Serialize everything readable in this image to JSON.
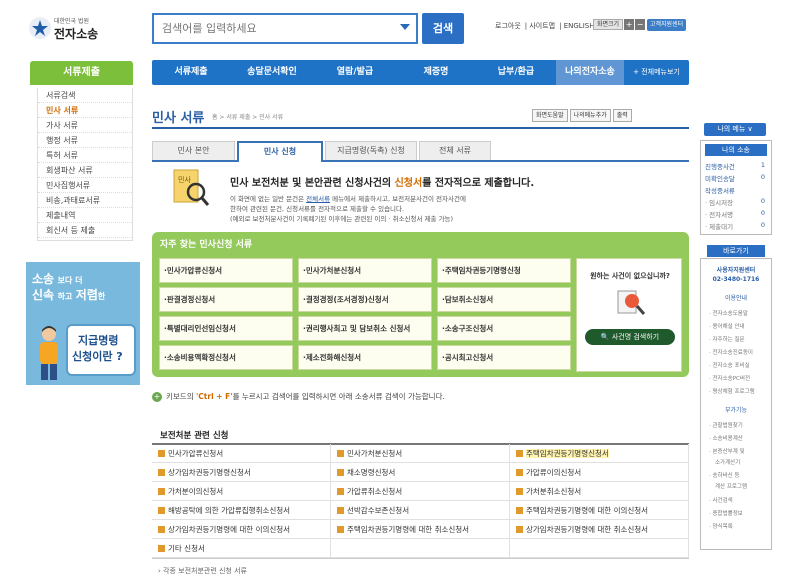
{
  "header": {
    "logo_sub": "대한민국 법원",
    "logo_main": "전자소송",
    "search_placeholder": "검색어를 입력하세요",
    "search_button": "검색",
    "top_links": [
      "로그아웃",
      "사이트맵",
      "ENGLISH"
    ],
    "font_label": "화면크기",
    "font_plus": "+",
    "font_minus": "−",
    "cs_center": "고객지원센터"
  },
  "mainnav": {
    "items": [
      "서류제출",
      "송달문서확인",
      "열람/발급",
      "제증명",
      "납부/환급",
      "나의전자소송"
    ],
    "all_menu": "+ 전체메뉴보기"
  },
  "leftnav": {
    "header": "서류제출",
    "items": [
      "서류검색",
      "민사 서류",
      "가사 서류",
      "행정 서류",
      "특허 서류",
      "회생파산 서류",
      "민사집행서류",
      "비송,과태료서류",
      "제출내역",
      "회신서 등 제출"
    ],
    "active_index": 1
  },
  "banner": {
    "line1_a": "소송",
    "line1_b": "보다 더",
    "line2_a": "신속",
    "line2_b": "하고",
    "line2_c": "저렴",
    "line2_d": "한",
    "bubble1": "지급명령",
    "bubble2": "신청이란 ?"
  },
  "page": {
    "title": "민사 서류",
    "breadcrumb": "홈 > 서류 제출 > 민사 서류",
    "tools": [
      "화면도움말",
      "나의메뉴추가",
      "출력"
    ]
  },
  "tabs": {
    "items": [
      "민사 본안",
      "민사 신청",
      "지급명령(독촉) 신청",
      "전체 서류"
    ],
    "active_index": 1
  },
  "intro": {
    "icon_label": "민사",
    "title_a": "민사 보전처분 및 본안관련 신청사건의 ",
    "title_em": "신청서",
    "title_b": "를 전자적으로 제출합니다.",
    "line1_a": "이 화면에 없는 일반 문건은 ",
    "line1_link": "전체서류",
    "line1_b": " 메뉴에서 제출하시고, 보전처분사건이 전자사건에",
    "line2": "한하여 관련된 문건, 신청서류를 전자적으로 제출할 수 있습니다.",
    "line3": "(예외로 보전처분사건이 기록폐기된 이후에는 관련된 이의 · 취소신청서 제출 가능)"
  },
  "frequent": {
    "title": "자주 찾는 민사신청 서류",
    "items": [
      "·민사가압류신청서",
      "·민사가처분신청서",
      "·주택임차권등기명령신청",
      "·판결경정신청서",
      "·결정경정(조서경정)신청서",
      "·담보취소신청서",
      "·특별대리인선임신청서",
      "·권리행사최고 및 담보취소 신청서",
      "·소송구조신청서",
      "·소송비용액확정신청서",
      "·제소전화해신청서",
      "·공시최고신청서"
    ],
    "right_question": "원하는 사건이 없으십니까?",
    "right_button": "사건명 검색하기"
  },
  "keyboard_tip": {
    "a": "키보드의 ",
    "em": "'Ctrl + F'",
    "b": "를 누르시고 검색어를 입력하시면 아래 소송서류 검색이 가능합니다."
  },
  "preservation": {
    "title": "보전처분 관련 신청",
    "items": [
      "민사가압류신청서",
      "민사가처분신청서",
      "주택임차권등기명령신청서",
      "상가임차권등기명령신청서",
      "채소명령신청서",
      "가압류이의신청서",
      "가처분이의신청서",
      "가압류취소신청서",
      "가처분취소신청서",
      "해방공탁에 의한 가압류집행취소신청서",
      "선박감수보존신청서",
      "주택임차권등기명령에 대한 이의신청서",
      "상가임차권등기명령에 대한 이의신청서",
      "주택임차권등기명령에 대한 취소신청서",
      "상가임차권등기명령에 대한 취소신청서",
      "기타 신청서"
    ],
    "highlight_index": 2,
    "more": "› 각종 보전처분관련 신청 서류"
  },
  "rightside": {
    "my_menu": "나의 메뉴 ∨",
    "my_case_head": "나의 소송",
    "rows": [
      {
        "label": "진행중사건",
        "num": "1",
        "style": "blue"
      },
      {
        "label": "미확인송달",
        "num": "0",
        "style": "blue"
      },
      {
        "label": "작성중서류",
        "num": "",
        "style": "blue"
      },
      {
        "label": "· 임시저장",
        "num": "0",
        "style": "gray"
      },
      {
        "label": "· 전자서명",
        "num": "0",
        "style": "gray"
      },
      {
        "label": "· 제출대기",
        "num": "0",
        "style": "gray"
      }
    ],
    "quick_head": "바로가기",
    "center_a": "사용자지원센터",
    "center_b": "02-3480-1716",
    "guide_head": "이용안내",
    "guide_items": [
      "전자소송도움말",
      "용어해설 안내",
      "자주하는 질문",
      "전자소송진료동이",
      "전자소송 포비실",
      "전자소송PC버전",
      "평상체험 프로그램"
    ],
    "extra_head": "부가기능",
    "extra_items": [
      "관할법원찾기",
      "소송비용계산",
      "본증산부계 및",
      "소가계산기",
      "송하바신 등",
      "계산 프로그램",
      "사건검색",
      "종합법률정보",
      "양식목록"
    ]
  }
}
